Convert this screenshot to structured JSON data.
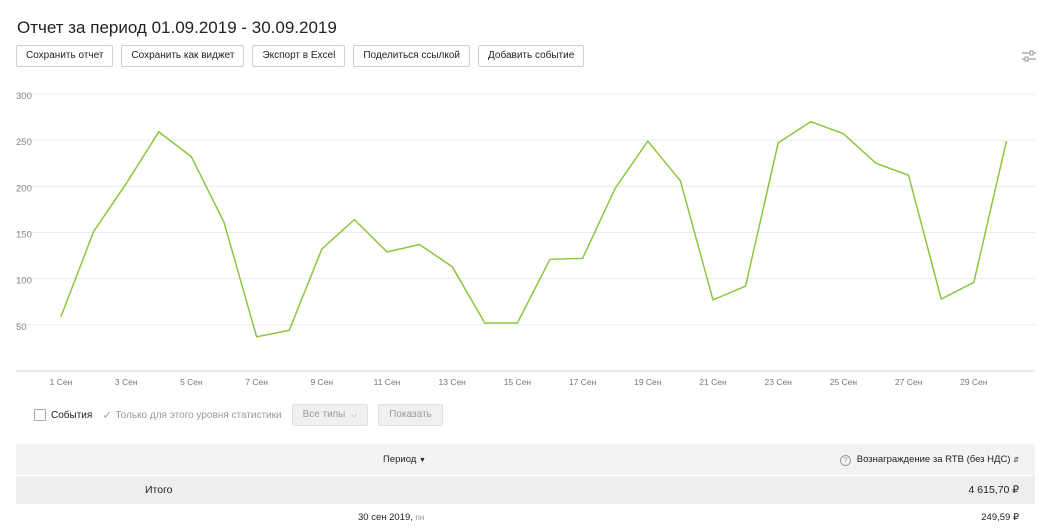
{
  "header": {
    "title": "Отчет за период 01.09.2019 - 30.09.2019"
  },
  "toolbar": {
    "save_report": "Сохранить отчет",
    "save_widget": "Сохранить как виджет",
    "export_excel": "Экспорт в Excel",
    "share_link": "Поделиться ссылкой",
    "add_event": "Добавить событие"
  },
  "icons": {
    "settings": "sliders-icon",
    "events_checkbox": "checkbox-icon",
    "level_check": "checkmark-icon",
    "dropdown": "chevron-down-icon",
    "info": "question-circle-icon",
    "sort": "sort-icon"
  },
  "colors": {
    "line": "#8cc63f",
    "grid": "#ebebeb"
  },
  "chart_data": {
    "type": "line",
    "x": [
      "1 Сен",
      "2 Сен",
      "3 Сен",
      "4 Сен",
      "5 Сен",
      "6 Сен",
      "7 Сен",
      "8 Сен",
      "9 Сен",
      "10 Сен",
      "11 Сен",
      "12 Сен",
      "13 Сен",
      "14 Сен",
      "15 Сен",
      "16 Сен",
      "17 Сен",
      "18 Сен",
      "19 Сен",
      "20 Сен",
      "21 Сен",
      "22 Сен",
      "23 Сен",
      "24 Сен",
      "25 Сен",
      "26 Сен",
      "27 Сен",
      "28 Сен",
      "29 Сен",
      "30 Сен"
    ],
    "x_tick_labels": [
      "1 Сен",
      "3 Сен",
      "5 Сен",
      "7 Сен",
      "9 Сен",
      "11 Сен",
      "13 Сен",
      "15 Сен",
      "17 Сен",
      "19 Сен",
      "21 Сен",
      "23 Сен",
      "25 Сен",
      "27 Сен",
      "29 Сен"
    ],
    "series": [
      {
        "values": [
          59,
          151,
          203,
          259,
          232,
          161,
          37,
          44,
          132,
          164,
          129,
          137,
          113,
          52,
          52,
          121,
          122,
          198,
          249,
          206,
          77,
          92,
          247,
          270,
          257,
          225,
          212,
          78,
          96,
          249
        ]
      }
    ],
    "y_ticks": [
      50,
      100,
      150,
      200,
      250,
      300
    ],
    "ylim": [
      0,
      300
    ],
    "grid": true
  },
  "controls": {
    "events_label": "События",
    "level_label": "Только для этого уровня статистики",
    "types_select": "Все типы",
    "show_button": "Показать"
  },
  "table": {
    "col_period": "Период",
    "col_reward": "Вознаграждение за RTB (без НДС)",
    "total_label": "Итого",
    "total_value": "4 615,70 ₽",
    "rows": [
      {
        "period": "30 сен 2019,",
        "weekday": "пн",
        "value": "249,59 ₽"
      }
    ]
  }
}
